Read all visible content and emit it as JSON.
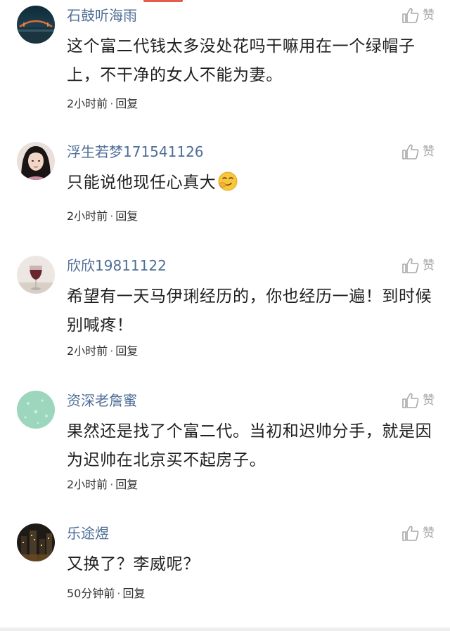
{
  "like_label": "赞",
  "reply_label": "回复",
  "separator": "·",
  "colors": {
    "username": "#4f6e96",
    "accent": "#e85a4f",
    "text": "#1f1f1f",
    "muted": "#a8a8a8"
  },
  "comments": [
    {
      "username": "石鼓听海雨",
      "avatar": "avatar-night-bridge",
      "content": "这个富二代钱太多没处花吗干嘛用在一个绿帽子上，不干净的女人不能为妻。",
      "time": "2小时前"
    },
    {
      "username": "浮生若梦171541126",
      "avatar": "avatar-woman-portrait",
      "content": "只能说他现任心真大",
      "emoji": "smirk-face-emoji",
      "time": "2小时前"
    },
    {
      "username": "欣欣19811122",
      "avatar": "avatar-wine-glass",
      "content": "希望有一天马伊琍经历的，你也经历一遍！到时候别喊疼！",
      "time": "2小时前"
    },
    {
      "username": "资深老詹蜜",
      "avatar": "avatar-green-pattern",
      "content": "果然还是找了个富二代。当初和迟帅分手，就是因为迟帅在北京买不起房子。",
      "time": "2小时前"
    },
    {
      "username": "乐途煜",
      "avatar": "avatar-city-night",
      "content": "又换了？李威呢？",
      "time": "50分钟前"
    }
  ]
}
